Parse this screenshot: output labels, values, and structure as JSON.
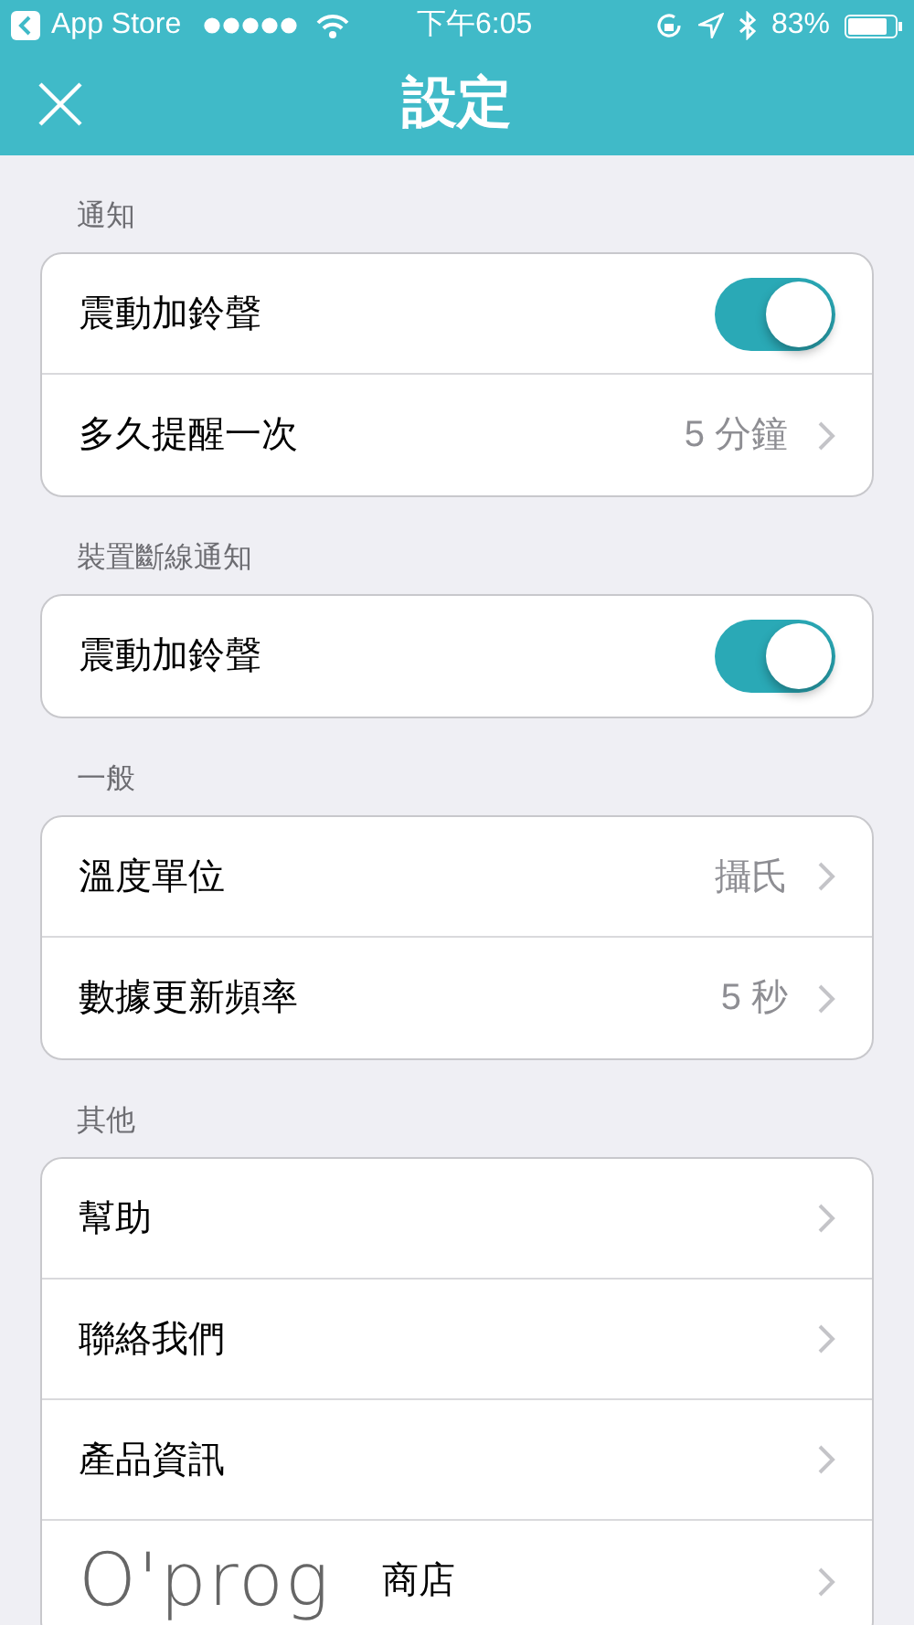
{
  "status_bar": {
    "back_app": "App Store",
    "time": "下午6:05",
    "battery": "83%"
  },
  "nav": {
    "title": "設定"
  },
  "sections": [
    {
      "title": "通知",
      "rows": [
        {
          "kind": "toggle",
          "label": "震動加鈴聲",
          "on": true
        },
        {
          "kind": "value",
          "label": "多久提醒一次",
          "value": "5 分鐘"
        }
      ]
    },
    {
      "title": "裝置斷線通知",
      "rows": [
        {
          "kind": "toggle",
          "label": "震動加鈴聲",
          "on": true
        }
      ]
    },
    {
      "title": "一般",
      "rows": [
        {
          "kind": "value",
          "label": "溫度單位",
          "value": "攝氏"
        },
        {
          "kind": "value",
          "label": "數據更新頻率",
          "value": "5 秒"
        }
      ]
    },
    {
      "title": "其他",
      "rows": [
        {
          "kind": "link",
          "label": "幫助"
        },
        {
          "kind": "link",
          "label": "聯絡我們"
        },
        {
          "kind": "link",
          "label": "產品資訊"
        },
        {
          "kind": "logo",
          "logo": "O'prog",
          "label": "商店"
        }
      ]
    }
  ]
}
